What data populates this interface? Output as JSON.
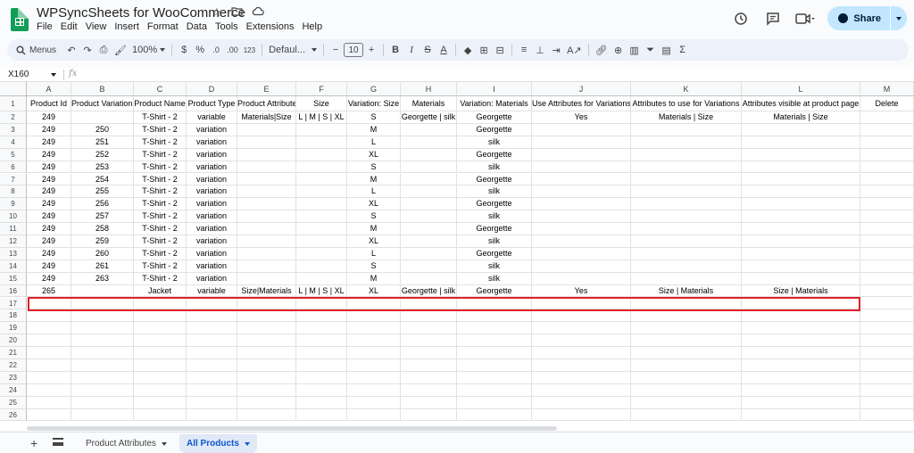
{
  "app": {
    "doc_title": "WPSyncSheets for WooCommerce",
    "menu": [
      "File",
      "Edit",
      "View",
      "Insert",
      "Format",
      "Data",
      "Tools",
      "Extensions",
      "Help"
    ],
    "share_label": "Share"
  },
  "toolbar": {
    "menus_label": "Menus",
    "zoom": "100%",
    "currency": "$",
    "percent": "%",
    "decimal_decrease": ".0",
    "decimal_increase": ".00",
    "number_format": "123",
    "font": "Defaul...",
    "font_size": "10",
    "bold": "B",
    "italic": "I",
    "text_color": "A"
  },
  "formula_bar": {
    "cell_ref": "X160",
    "fx": "fx",
    "value": ""
  },
  "columns": [
    "A",
    "B",
    "C",
    "D",
    "E",
    "F",
    "G",
    "H",
    "I",
    "J",
    "K",
    "L",
    "M"
  ],
  "rows": [
    [
      "Product Id",
      "Product Variation Id",
      "Product Name",
      "Product Type",
      "Product Attributes",
      "Size",
      "Variation: Size",
      "Materials",
      "Variation: Materials",
      "Use Attributes for Variations",
      "Attributes to use for Variations",
      "Attributes visible at product page",
      "Delete"
    ],
    [
      "249",
      "",
      "T-Shirt - 2",
      "variable",
      "Materials|Size",
      "L | M | S | XL",
      "S",
      "Georgette | silk",
      "Georgette",
      "Yes",
      "Materials | Size",
      "Materials | Size",
      ""
    ],
    [
      "249",
      "250",
      "T-Shirt - 2",
      "variation",
      "",
      "",
      "M",
      "",
      "Georgette",
      "",
      "",
      "",
      ""
    ],
    [
      "249",
      "251",
      "T-Shirt - 2",
      "variation",
      "",
      "",
      "L",
      "",
      "silk",
      "",
      "",
      "",
      ""
    ],
    [
      "249",
      "252",
      "T-Shirt - 2",
      "variation",
      "",
      "",
      "XL",
      "",
      "Georgette",
      "",
      "",
      "",
      ""
    ],
    [
      "249",
      "253",
      "T-Shirt - 2",
      "variation",
      "",
      "",
      "S",
      "",
      "silk",
      "",
      "",
      "",
      ""
    ],
    [
      "249",
      "254",
      "T-Shirt - 2",
      "variation",
      "",
      "",
      "M",
      "",
      "Georgette",
      "",
      "",
      "",
      ""
    ],
    [
      "249",
      "255",
      "T-Shirt - 2",
      "variation",
      "",
      "",
      "L",
      "",
      "silk",
      "",
      "",
      "",
      ""
    ],
    [
      "249",
      "256",
      "T-Shirt - 2",
      "variation",
      "",
      "",
      "XL",
      "",
      "Georgette",
      "",
      "",
      "",
      ""
    ],
    [
      "249",
      "257",
      "T-Shirt - 2",
      "variation",
      "",
      "",
      "S",
      "",
      "silk",
      "",
      "",
      "",
      ""
    ],
    [
      "249",
      "258",
      "T-Shirt - 2",
      "variation",
      "",
      "",
      "M",
      "",
      "Georgette",
      "",
      "",
      "",
      ""
    ],
    [
      "249",
      "259",
      "T-Shirt - 2",
      "variation",
      "",
      "",
      "XL",
      "",
      "silk",
      "",
      "",
      "",
      ""
    ],
    [
      "249",
      "260",
      "T-Shirt - 2",
      "variation",
      "",
      "",
      "L",
      "",
      "Georgette",
      "",
      "",
      "",
      ""
    ],
    [
      "249",
      "261",
      "T-Shirt - 2",
      "variation",
      "",
      "",
      "S",
      "",
      "silk",
      "",
      "",
      "",
      ""
    ],
    [
      "249",
      "263",
      "T-Shirt - 2",
      "variation",
      "",
      "",
      "M",
      "",
      "silk",
      "",
      "",
      "",
      ""
    ],
    [
      "265",
      "",
      "Jacket",
      "variable",
      "Size|Materials",
      "L | M | S | XL",
      "XL",
      "Georgette | silk",
      "Georgette",
      "Yes",
      "Size | Materials",
      "Size | Materials",
      ""
    ]
  ],
  "visible_row_count": 26,
  "sheet_tabs": [
    {
      "label": "Product Attributes",
      "active": false
    },
    {
      "label": "All Products",
      "active": true
    }
  ],
  "colors": {
    "highlight_border": "#e0202a",
    "share_bg": "#c2e7ff",
    "active_tab": "#0b57d0",
    "sheets_green": "#0f9d58"
  }
}
